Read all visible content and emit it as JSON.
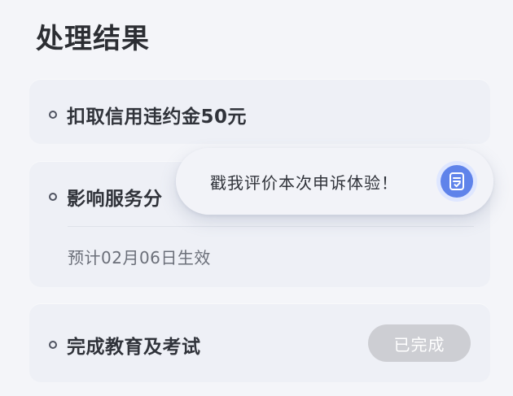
{
  "page": {
    "title": "处理结果"
  },
  "results": [
    {
      "label": "扣取信用违约金50元"
    },
    {
      "label": "影响服务分",
      "note": "预计02月06日生效"
    },
    {
      "label": "完成教育及考试",
      "status": "已完成"
    }
  ],
  "feedback_prompt": {
    "text": "戳我评价本次申诉体验！",
    "icon": "feedback-doc-icon"
  },
  "colors": {
    "background": "#f4f5f9",
    "card": "#eef0f6",
    "primary_text": "#30333a",
    "secondary_text": "#6b6f79",
    "status_badge": "#cdced3",
    "accent": "#5f83ea"
  }
}
